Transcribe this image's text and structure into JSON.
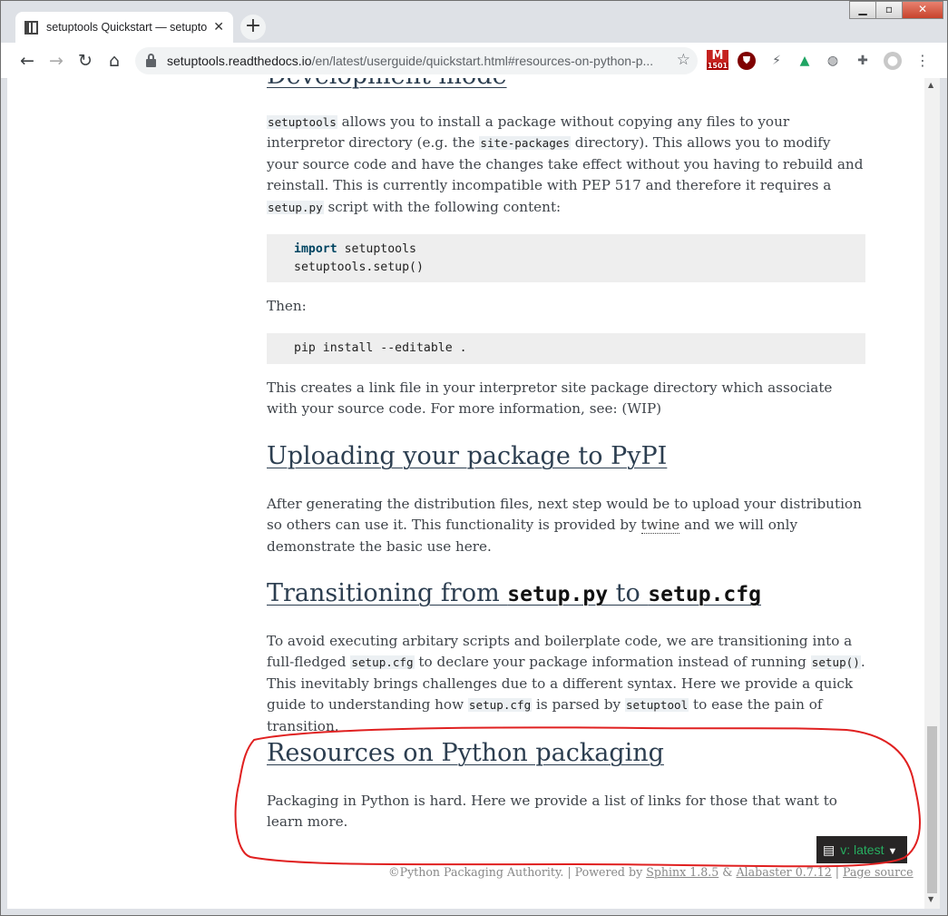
{
  "browser": {
    "tab_title": "setuptools Quickstart — setupto...",
    "tab_close": "✕",
    "new_tab": "+",
    "url_domain": "setuptools.readthedocs.io",
    "url_path": "/en/latest/userguide/quickstart.html#resources-on-python-p...",
    "gmail_count": "1501",
    "window_controls": {
      "minimize": "▁",
      "maximize": "▫",
      "close": "✕"
    }
  },
  "page": {
    "development": {
      "heading": "Development mode",
      "p1_code1": "setuptools",
      "p1_t1": " allows you to install a package without copying any files to your interpretor directory (e.g. the ",
      "p1_code2": "site-packages",
      "p1_t2": " directory). This allows you to modify your source code and have the changes take effect without you having to rebuild and reinstall. This is currently incompatible with PEP 517 and therefore it requires a ",
      "p1_code3": "setup.py",
      "p1_t3": " script with the following content:",
      "code1_kw": "import",
      "code1_line1_rest": " setuptools",
      "code1_line2": "setuptools.setup()",
      "then": "Then:",
      "code2": "pip install --editable .",
      "p2": "This creates a link file in your interpretor site package directory which associate with your source code. For more information, see: (WIP)"
    },
    "uploading": {
      "heading": "Uploading your package to PyPI",
      "p_t1": "After generating the distribution files, next step would be to upload your distribution so others can use it. This functionality is provided by ",
      "p_link": "twine",
      "p_t2": " and we will only demonstrate the basic use here."
    },
    "transitioning": {
      "heading_t1": "Transitioning from ",
      "heading_code1": "setup.py",
      "heading_t2": " to ",
      "heading_code2": "setup.cfg",
      "p_t1": "To avoid executing arbitary scripts and boilerplate code, we are transitioning into a full-fledged ",
      "p_code1": "setup.cfg",
      "p_t2": " to declare your package information instead of running ",
      "p_code2": "setup()",
      "p_t3": ". This inevitably brings challenges due to a different syntax. Here we provide a quick guide to understanding how ",
      "p_code3": "setup.cfg",
      "p_t4": " is parsed by ",
      "p_code4": "setuptool",
      "p_t5": " to ease the pain of transition."
    },
    "resources": {
      "heading": "Resources on Python packaging",
      "p": "Packaging in Python is hard. Here we provide a list of links for those that want to learn more."
    },
    "footer": {
      "copyright": "©Python Packaging Authority. | Powered by ",
      "sphinx": "Sphinx 1.8.5",
      "amp": " & ",
      "alabaster": "Alabaster 0.7.12",
      "sep": " | ",
      "page_source": "Page source"
    },
    "version_badge": "v: latest"
  },
  "colors": {
    "heading": "#2c3e50",
    "text": "#3e4349",
    "annotation": "#e02020",
    "badge_bg": "#272525",
    "badge_text": "#27ae60"
  }
}
